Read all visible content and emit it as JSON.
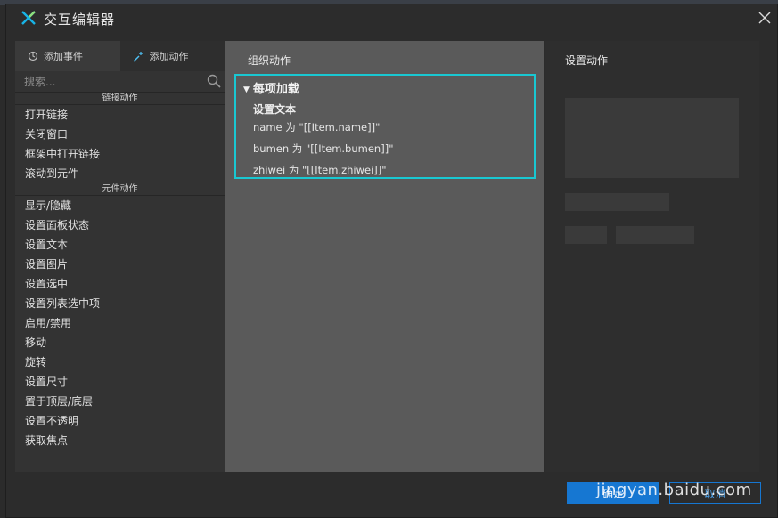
{
  "window": {
    "title": "交互编辑器"
  },
  "left_panel": {
    "tabs": [
      {
        "label": "添加事件",
        "icon": "event-icon"
      },
      {
        "label": "添加动作",
        "icon": "add-action-icon"
      }
    ],
    "search": {
      "placeholder": "搜索..."
    },
    "groups": [
      {
        "title": "链接动作",
        "items": [
          "打开链接",
          "关闭窗口",
          "框架中打开链接",
          "滚动到元件"
        ]
      },
      {
        "title": "元件动作",
        "items": [
          "显示/隐藏",
          "设置面板状态",
          "设置文本",
          "设置图片",
          "设置选中",
          "设置列表选中项",
          "启用/禁用",
          "移动",
          "旋转",
          "设置尺寸",
          "置于顶层/底层",
          "设置不透明",
          "获取焦点"
        ]
      }
    ]
  },
  "middle_panel": {
    "header": "组织动作",
    "event": {
      "title": "每项加载",
      "action_title": "设置文本",
      "lines": [
        "name 为 \"[[Item.name]]\"",
        "bumen 为 \"[[Item.bumen]]\"",
        "zhiwei 为 \"[[Item.zhiwei]]\""
      ]
    }
  },
  "right_panel": {
    "header": "设置动作"
  },
  "footer": {
    "ok_label": "确定",
    "cancel_label": "取消"
  },
  "watermark": "jingyan.baidu.com",
  "colors": {
    "accent": "#19c8d2",
    "primary_button": "#1677d2",
    "middle_bg": "#5a5a5a"
  }
}
